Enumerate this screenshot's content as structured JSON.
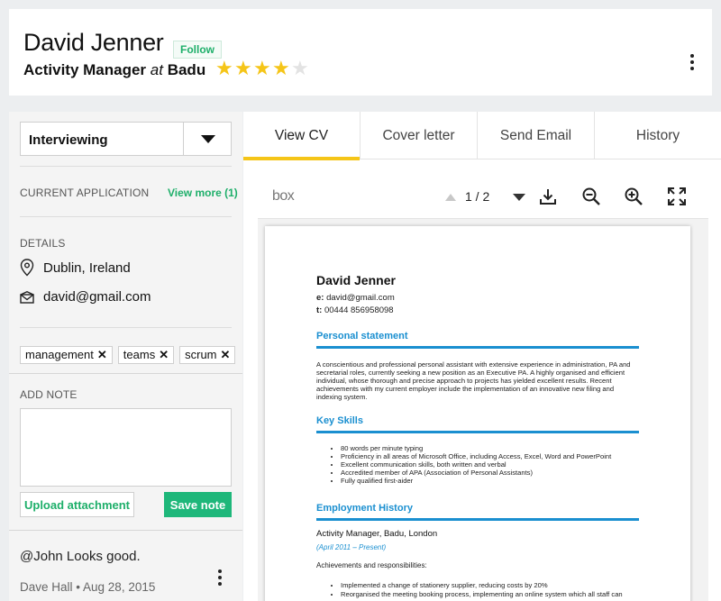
{
  "profile": {
    "name": "David Jenner",
    "follow_label": "Follow",
    "role": "Activity Manager",
    "at_word": "at",
    "company": "Badu",
    "rating": 4,
    "rating_max": 5
  },
  "sidebar": {
    "status_value": "Interviewing",
    "current_application_label": "CURRENT APPLICATION",
    "view_more_label": "View more (1)",
    "details_label": "DETAILS",
    "location": "Dublin, Ireland",
    "email": "david@gmail.com",
    "tags": [
      "management",
      "teams",
      "scrum"
    ],
    "add_note_label": "ADD NOTE",
    "upload_label": "Upload attachment",
    "save_label": "Save note",
    "comment": {
      "text": "@John Looks good.",
      "author": "Dave Hall",
      "date": "Aug 28, 2015"
    }
  },
  "tabs": [
    {
      "label": "View CV",
      "active": true
    },
    {
      "label": "Cover letter",
      "active": false
    },
    {
      "label": "Send Email",
      "active": false
    },
    {
      "label": "History",
      "active": false
    }
  ],
  "viewer": {
    "logo": "box",
    "page_indicator": "1 / 2",
    "icons": [
      "download-icon",
      "zoom-out-icon",
      "zoom-in-icon",
      "fullscreen-icon"
    ]
  },
  "cv": {
    "name": "David Jenner",
    "email_label": "e:",
    "email": "david@gmail.com",
    "phone_label": "t:",
    "phone": "00444 856958098",
    "personal_heading": "Personal statement",
    "personal_text": "A conscientious and professional personal assistant with extensive experience in administration, PA and secretarial roles, currently seeking a new position as an Executive PA. A highly organised and efficient individual, whose thorough and precise approach to projects has yielded excellent results. Recent achievements with my current employer include the implementation of an innovative new filing and indexing system.",
    "skills_heading": "Key Skills",
    "skills": [
      "80 words per minute typing",
      "Proficiency in all areas of Microsoft Office, including Access, Excel, Word and PowerPoint",
      "Excellent communication skills, both written and verbal",
      "Accredited member of APA (Association of Personal Assistants)",
      "Fully qualified first-aider"
    ],
    "employment_heading": "Employment History",
    "job_title": "Activity Manager, Badu, London",
    "job_dates": "(April 2011 – Present)",
    "responsibilities_label": "Achievements and responsibilities:",
    "responsibilities": [
      "Implemented a change of stationery supplier, reducing costs by 20%",
      "Reorganised the meeting booking process, implementing an online system which all staff can"
    ]
  },
  "colors": {
    "accent_green": "#1eb77a",
    "star_gold": "#f5c518",
    "tab_underline": "#f5c518",
    "cv_blue": "#1a8fd0"
  }
}
